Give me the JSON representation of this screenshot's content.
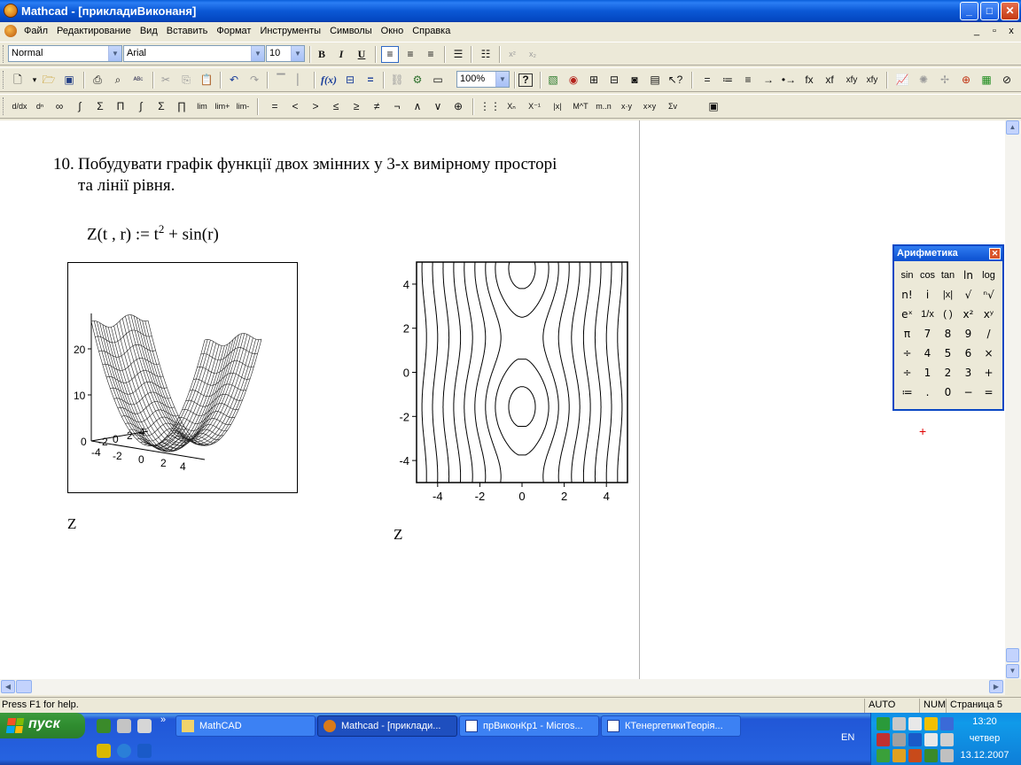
{
  "window": {
    "title": "Mathcad - [прикладиВиконаня]",
    "buttons": {
      "minimize": "_",
      "maximize": "□",
      "close": "✕"
    }
  },
  "menubar": {
    "items": [
      "Файл",
      "Редактирование",
      "Вид",
      "Вставить",
      "Формат",
      "Инструменты",
      "Символы",
      "Окно",
      "Справка"
    ],
    "mdi": {
      "minimize": "_",
      "restore": "▫",
      "close": "x"
    }
  },
  "format_toolbar": {
    "style": "Normal",
    "font": "Arial",
    "size": "10",
    "bold": "B",
    "italic": "I",
    "underline": "U",
    "superscript": "x²",
    "subscript": "x₂"
  },
  "standard_toolbar": {
    "zoom": "100%",
    "function_label": "f(x)",
    "help": "?",
    "eval_symbols": [
      "=",
      "≔",
      "≡",
      "→",
      "•→",
      "fx",
      "xf",
      "xfy",
      "xfy"
    ]
  },
  "calculus_toolbar": {
    "operators": [
      "=",
      "<",
      ">",
      "≤",
      "≥",
      "≠",
      "¬",
      "∧",
      "∨",
      "⊕"
    ],
    "matrix": [
      "Xₙ",
      "X⁻¹",
      "|x|",
      "M^T",
      "m..n",
      "x·y",
      "x×y",
      "Σv"
    ]
  },
  "document": {
    "task_number": "10.",
    "task_line1": "Побудувати графік функції двох змінних у 3-х вимірному просторі",
    "task_line2": "та лінії рівня.",
    "formula_lhs": "Z(t , r)",
    "formula_assign": ":=",
    "formula_t": "t",
    "formula_exp": "2",
    "formula_rest": "+ sin(r)",
    "plot3d_label": "Z",
    "contour_label": "Z",
    "plot3d_axis": {
      "z_ticks": [
        "20",
        "10",
        "0"
      ],
      "y_ticks": [
        "-2",
        "0",
        "2",
        "4"
      ],
      "x_ticks": [
        "-4",
        "-2",
        "0",
        "2",
        "4"
      ]
    }
  },
  "chart_data": {
    "type": "contour",
    "title": "",
    "xlabel": "",
    "ylabel": "",
    "xlim": [
      -5,
      5
    ],
    "ylim": [
      -5,
      5
    ],
    "x_ticks": [
      "-4",
      "-2",
      "0",
      "2",
      "4"
    ],
    "y_ticks": [
      "4",
      "2",
      "0",
      "-2",
      "-4"
    ],
    "function": "Z(t,r) = t^2 + sin(r)",
    "levels": [
      -0.6,
      0.6,
      2,
      4,
      6.5,
      9.5,
      13,
      17,
      21.5
    ]
  },
  "palette": {
    "title": "Арифметика",
    "close": "✕",
    "keys": [
      "sin",
      "cos",
      "tan",
      "ln",
      "log",
      "n!",
      "i",
      "|x|",
      "√",
      "ⁿ√",
      "eˣ",
      "1/x",
      "( )",
      "x²",
      "xʸ",
      "π",
      "7",
      "8",
      "9",
      "/",
      "÷",
      "4",
      "5",
      "6",
      "×",
      "÷",
      "1",
      "2",
      "3",
      "+",
      "≔",
      ".",
      "0",
      "−",
      "="
    ]
  },
  "statusbar": {
    "help": "Press F1 for help.",
    "mode": "AUTO",
    "num": "NUM",
    "page": "Страница 5"
  },
  "taskbar": {
    "start": "пуск",
    "tasks": [
      "MathCAD",
      "Mathcad - [приклади...",
      "прВиконКр1 - Micros...",
      "КТенергетикиТеорія..."
    ],
    "language": "EN",
    "time": "13:20",
    "day": "четвер",
    "date": "13.12.2007"
  },
  "colors": {
    "titlebar": "#0b58d5",
    "taskbar": "#2663e0",
    "start": "#2f8c2f",
    "cursor_mark": "#e00000"
  }
}
